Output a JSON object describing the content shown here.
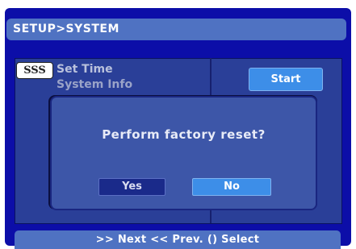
{
  "header": {
    "breadcrumb": "SETUP>SYSTEM"
  },
  "menu": {
    "icon_text": "SSS",
    "items": [
      {
        "label": "Set Time"
      },
      {
        "label": "System Info"
      }
    ]
  },
  "action": {
    "start_label": "Start"
  },
  "dialog": {
    "message": "Perform factory reset?",
    "yes_label": "Yes",
    "no_label": "No",
    "selected": "No"
  },
  "footer": {
    "hint": ">> Next  << Prev.  () Select"
  },
  "colors": {
    "bezel": "#0c0ea8",
    "bar": "#4f72c2",
    "panel": "#2a3f98",
    "highlight": "#3d8ee8",
    "text": "#ffffff"
  }
}
